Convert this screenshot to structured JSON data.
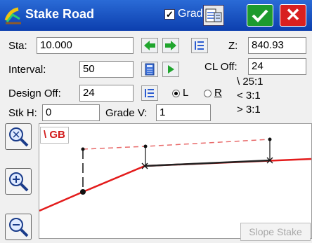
{
  "window": {
    "title": "Stake Road",
    "grade_label": "Grade",
    "grade_checked": true
  },
  "fields": {
    "sta_label": "Sta:",
    "sta_value": "10.000",
    "z_label": "Z:",
    "z_value": "840.93",
    "interval_label": "Interval:",
    "interval_value": "50",
    "cl_off_label": "CL Off:",
    "cl_off_value": "24",
    "design_off_label": "Design Off:",
    "design_off_value": "24",
    "side_left": "L",
    "side_right": "R",
    "side_selected": "L",
    "stk_h_label": "Stk H:",
    "stk_h_value": "0",
    "grade_v_label": "Grade V:",
    "grade_v_value": "1"
  },
  "slopes": {
    "ratio_1": "\\ 25:1",
    "ratio_2": "< 3:1",
    "ratio_3": "> 3:1"
  },
  "plot": {
    "tag": "\\ GB",
    "slope_stake_label": "Slope Stake"
  },
  "colors": {
    "titlebar": "#1a52c4",
    "ok": "#1d9a2e",
    "close": "#d82020",
    "grade_line": "#e31b1b",
    "design_line": "#222222"
  },
  "icons": {
    "app": "road-stake-icon",
    "grade_button": "grade-sheet-icon",
    "ok": "checkmark-icon",
    "close": "close-x-icon",
    "prev": "arrow-left-icon",
    "next": "arrow-right-icon",
    "list": "list-icon",
    "calc": "calculator-icon",
    "play": "play-icon",
    "zoom_extents": "zoom-extents-icon",
    "zoom_in": "zoom-in-icon",
    "zoom_out": "zoom-out-icon"
  }
}
